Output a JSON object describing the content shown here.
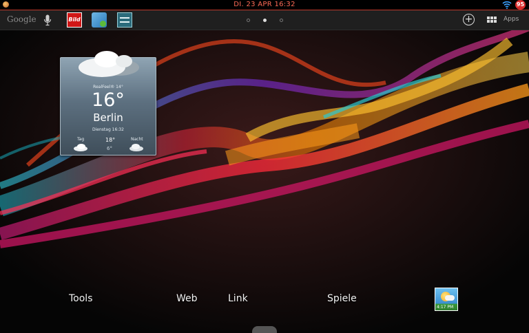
{
  "status_bar": {
    "datetime": "DI. 23 APR 16:32",
    "battery": "95",
    "icons": [
      "notification-icon",
      "wifi-icon",
      "battery-icon"
    ]
  },
  "top_bar": {
    "google": "Google",
    "bild": "Bild",
    "apps_label": "Apps",
    "page_count": 3,
    "active_page": 2,
    "icons": [
      "microphone-icon",
      "bild-app-icon",
      "gallery-app-icon",
      "settings-app-icon",
      "add-icon",
      "apps-grid-icon"
    ]
  },
  "weather": {
    "realfeel": "RealFeel® 14°",
    "temperature": "16°",
    "city": "Berlin",
    "datetime": "Dienstag 16:32",
    "day_label": "Tag",
    "night_label": "Nacht",
    "high": "18°",
    "low": "6°"
  },
  "dock": {
    "folders": [
      "Tools",
      "Web",
      "Link",
      "Spiele"
    ],
    "weather_icon_text": "4:17 PM"
  },
  "colors": {
    "status_accent": "#c0392b",
    "status_text": "#ff6b57",
    "battery": "#d92c2c"
  }
}
